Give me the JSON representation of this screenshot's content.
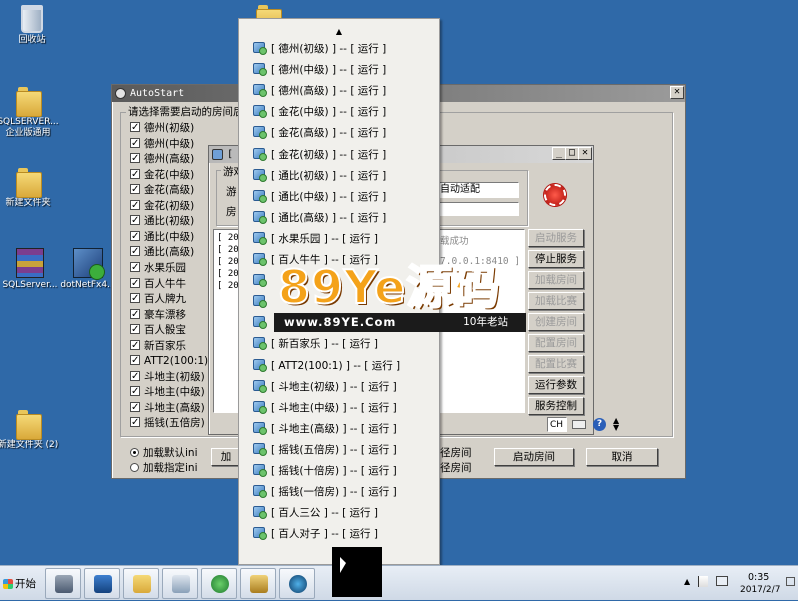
{
  "desktop": {
    "icons": [
      {
        "label": "回收站",
        "icon": "recycle-bin-icon"
      },
      {
        "label": "SQLSERVER... 企业版通用",
        "icon": "folder-icon"
      },
      {
        "label": "新建文件夹",
        "icon": "folder-icon"
      },
      {
        "label": "SQLServer...",
        "icon": "winrar-archive-icon"
      },
      {
        "label": "dotNetFx4...",
        "icon": "setup-installer-icon"
      },
      {
        "label": "新建文件夹 (2)",
        "icon": "folder-icon"
      }
    ]
  },
  "autostart": {
    "title": "AutoStart",
    "group_label": "请选择需要启动的房间后，",
    "rooms": [
      {
        "label": "德州(初级)",
        "checked": true
      },
      {
        "label": "德州(中级)",
        "checked": true
      },
      {
        "label": "德州(高级)",
        "checked": true
      },
      {
        "label": "金花(中级)",
        "checked": true
      },
      {
        "label": "金花(高级)",
        "checked": true
      },
      {
        "label": "金花(初级)",
        "checked": true
      },
      {
        "label": "通比(初级)",
        "checked": true
      },
      {
        "label": "通比(中级)",
        "checked": true
      },
      {
        "label": "通比(高级)",
        "checked": true
      },
      {
        "label": "水果乐园",
        "checked": true
      },
      {
        "label": "百人牛牛",
        "checked": true
      },
      {
        "label": "百人牌九",
        "checked": true
      },
      {
        "label": "豪车漂移",
        "checked": true
      },
      {
        "label": "百人骰宝",
        "checked": true
      },
      {
        "label": "新百家乐",
        "checked": true
      },
      {
        "label": "ATT2(100:1)",
        "checked": true
      },
      {
        "label": "斗地主(初级)",
        "checked": true
      },
      {
        "label": "斗地主(中级)",
        "checked": true
      },
      {
        "label": "斗地主(高级)",
        "checked": true
      },
      {
        "label": "摇钱(五倍房)",
        "checked": true
      }
    ],
    "radio_default": "加载默认ini",
    "radio_custom": "加载指定ini",
    "load_button": "加",
    "text_room_a": "径房间",
    "text_room_b": "径房间",
    "start_room_button": "启动房间",
    "cancel_button": "取消"
  },
  "inner_window": {
    "title": "[",
    "game_label": "游戏",
    "play_label": "游",
    "room_label": "房",
    "auto_adapt": "自动适配",
    "status_success": "载成功",
    "address": "7.0.0.1:8410 ]",
    "log_lines": [
      "[ 20",
      "[ 20",
      "[ 20",
      "[ 20",
      "[ 20"
    ],
    "buttons": [
      {
        "label": "启动服务",
        "enabled": false
      },
      {
        "label": "停止服务",
        "enabled": true
      },
      {
        "label": "加载房间",
        "enabled": false
      },
      {
        "label": "加载比赛",
        "enabled": false
      },
      {
        "label": "创建房间",
        "enabled": false
      },
      {
        "label": "配置房间",
        "enabled": false
      },
      {
        "label": "配置比赛",
        "enabled": false
      },
      {
        "label": "运行参数",
        "enabled": true
      },
      {
        "label": "服务控制",
        "enabled": true
      }
    ],
    "lang_indicator": "CH"
  },
  "popup_menu": {
    "scroll_up": "▲",
    "items": [
      "[ 德州(初级) ] -- [ 运行 ]",
      "[ 德州(中级) ] -- [ 运行 ]",
      "[ 德州(高级) ] -- [ 运行 ]",
      "[ 金花(中级) ] -- [ 运行 ]",
      "[ 金花(高级) ] -- [ 运行 ]",
      "[ 金花(初级) ] -- [ 运行 ]",
      "[ 通比(初级) ] -- [ 运行 ]",
      "[ 通比(中级) ] -- [ 运行 ]",
      "[ 通比(高级) ] -- [ 运行 ]",
      "[ 水果乐园 ] -- [ 运行 ]",
      "[ 百人牛牛 ] -- [ 运行 ]",
      "",
      "",
      "",
      "[ 新百家乐 ] -- [ 运行 ]",
      "[ ATT2(100:1) ] -- [ 运行 ]",
      "[ 斗地主(初级) ] -- [ 运行 ]",
      "[ 斗地主(中级) ] -- [ 运行 ]",
      "[ 斗地主(高级) ] -- [ 运行 ]",
      "[ 摇钱(五倍房) ] -- [ 运行 ]",
      "[ 摇钱(十倍房) ] -- [ 运行 ]",
      "[ 摇钱(一倍房) ] -- [ 运行 ]",
      "[ 百人三公 ] -- [ 运行 ]",
      "[ 百人对子 ] -- [ 运行 ]"
    ]
  },
  "watermark": {
    "brand": "89Ye源码",
    "url": "www.89YE.Com",
    "tagline": "10年老站"
  },
  "taskbar": {
    "start_label": "开始",
    "apps": [
      "server-manager-icon",
      "powershell-icon",
      "file-explorer-icon",
      "network-tool-icon",
      "recycle-arrows-icon",
      "key-tools-icon",
      "browser-icon",
      "active-app-icon"
    ],
    "time": "0:35",
    "date": "2017/2/7"
  }
}
